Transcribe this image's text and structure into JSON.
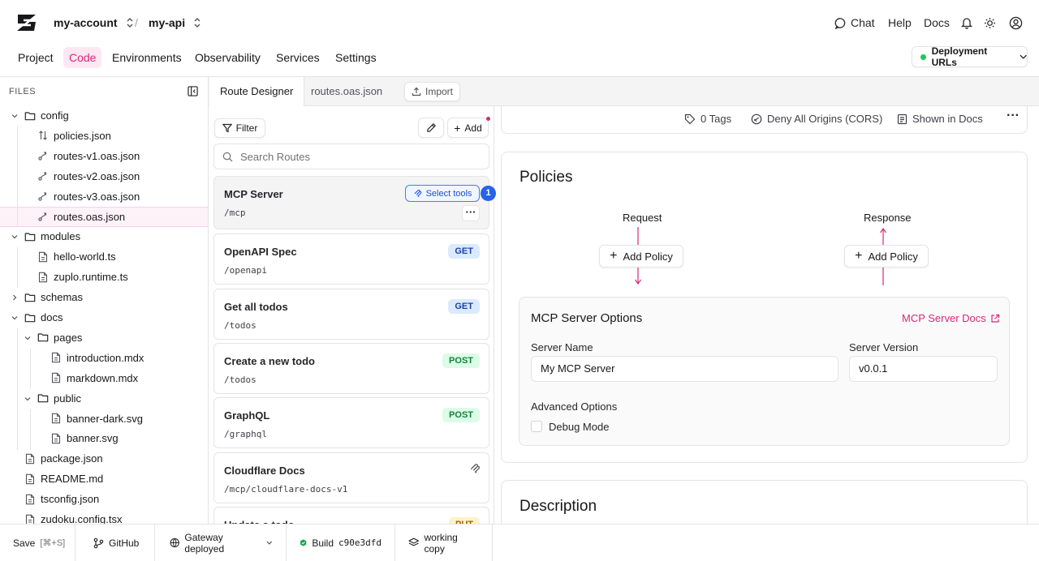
{
  "header": {
    "account": "my-account",
    "separator": "/",
    "project": "my-api",
    "chat_label": "Chat",
    "help_label": "Help",
    "docs_label": "Docs",
    "nav": [
      "Project",
      "Code",
      "Environments",
      "Observability",
      "Services",
      "Settings"
    ],
    "active_nav": "Code",
    "deployment_label": "Deployment URLs",
    "deployment_status_color": "#22c55e",
    "accent_color": "#db2777"
  },
  "sidebar": {
    "title": "FILES",
    "tree": [
      {
        "label": "config",
        "type": "folder"
      },
      {
        "label": "policies.json",
        "type": "policy-file"
      },
      {
        "label": "routes-v1.oas.json",
        "type": "route-file"
      },
      {
        "label": "routes-v2.oas.json",
        "type": "route-file"
      },
      {
        "label": "routes-v3.oas.json",
        "type": "route-file"
      },
      {
        "label": "routes.oas.json",
        "type": "route-file",
        "selected": true
      },
      {
        "label": "modules",
        "type": "folder"
      },
      {
        "label": "hello-world.ts",
        "type": "file"
      },
      {
        "label": "zuplo.runtime.ts",
        "type": "file"
      },
      {
        "label": "schemas",
        "type": "folder"
      },
      {
        "label": "docs",
        "type": "folder"
      },
      {
        "label": "pages",
        "type": "folder"
      },
      {
        "label": "introduction.mdx",
        "type": "file"
      },
      {
        "label": "markdown.mdx",
        "type": "file"
      },
      {
        "label": "public",
        "type": "folder"
      },
      {
        "label": "banner-dark.svg",
        "type": "file"
      },
      {
        "label": "banner.svg",
        "type": "file"
      },
      {
        "label": "package.json",
        "type": "file"
      },
      {
        "label": "README.md",
        "type": "file"
      },
      {
        "label": "tsconfig.json",
        "type": "file"
      },
      {
        "label": "zudoku.config.tsx",
        "type": "file"
      }
    ]
  },
  "tabs": {
    "items": [
      "Route Designer",
      "routes.oas.json"
    ],
    "active": "Route Designer",
    "import_label": "Import"
  },
  "routes_panel": {
    "filter_label": "Filter",
    "add_label": "Add",
    "search_placeholder": "Search Routes",
    "select_tools_label": "Select tools",
    "select_tools_count": "1",
    "routes": [
      {
        "name": "MCP Server",
        "path": "/mcp",
        "method": "",
        "selected": true
      },
      {
        "name": "OpenAPI Spec",
        "path": "/openapi",
        "method": "GET"
      },
      {
        "name": "Get all todos",
        "path": "/todos",
        "method": "GET"
      },
      {
        "name": "Create a new todo",
        "path": "/todos",
        "method": "POST"
      },
      {
        "name": "GraphQL",
        "path": "/graphql",
        "method": "POST"
      },
      {
        "name": "Cloudflare Docs",
        "path": "/mcp/cloudflare-docs-v1",
        "method": "",
        "icon": "mcp-icon"
      },
      {
        "name": "Update a todo",
        "path": "",
        "method": "PUT"
      }
    ]
  },
  "route_meta": {
    "tags": "0 Tags",
    "cors": "Deny All Origins (CORS)",
    "docs": "Shown in Docs"
  },
  "policies": {
    "title": "Policies",
    "request_label": "Request",
    "response_label": "Response",
    "add_policy_label": "Add Policy"
  },
  "mcp_options": {
    "title": "MCP Server Options",
    "docs_link": "MCP Server Docs",
    "server_name_label": "Server Name",
    "server_name_value": "My MCP Server",
    "server_version_label": "Server Version",
    "server_version_value": "v0.0.1",
    "advanced_label": "Advanced Options",
    "debug_label": "Debug Mode",
    "debug_checked": false
  },
  "description": {
    "title": "Description"
  },
  "bottom_bar": {
    "save_label": "Save",
    "save_shortcut": "[⌘+S]",
    "github_label": "GitHub",
    "gateway_label": "Gateway deployed",
    "build_label": "Build",
    "build_hash": "c90e3dfd",
    "working_copy_label": "working copy"
  }
}
